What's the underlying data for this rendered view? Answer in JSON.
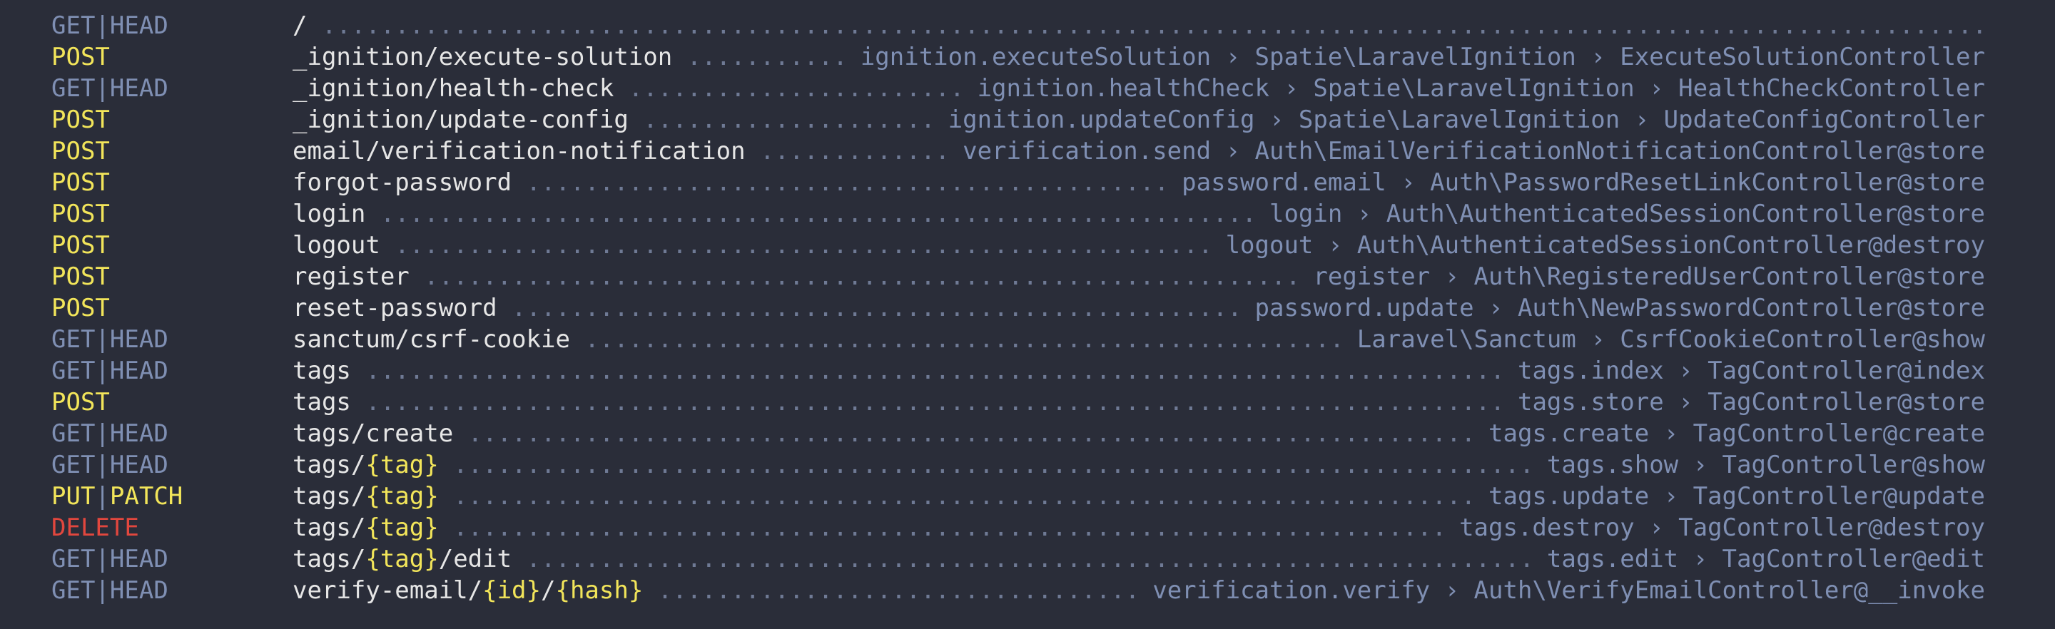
{
  "routes": [
    {
      "method": "GET|HEAD",
      "method_type": "get",
      "uri": "/",
      "target": ""
    },
    {
      "method": "POST",
      "method_type": "post",
      "uri": "_ignition/execute-solution",
      "target": "ignition.executeSolution › Spatie\\LaravelIgnition › ExecuteSolutionController"
    },
    {
      "method": "GET|HEAD",
      "method_type": "get",
      "uri": "_ignition/health-check",
      "target": "ignition.healthCheck › Spatie\\LaravelIgnition › HealthCheckController"
    },
    {
      "method": "POST",
      "method_type": "post",
      "uri": "_ignition/update-config",
      "target": "ignition.updateConfig › Spatie\\LaravelIgnition › UpdateConfigController"
    },
    {
      "method": "POST",
      "method_type": "post",
      "uri": "email/verification-notification",
      "target": "verification.send › Auth\\EmailVerificationNotificationController@store"
    },
    {
      "method": "POST",
      "method_type": "post",
      "uri": "forgot-password",
      "target": "password.email › Auth\\PasswordResetLinkController@store"
    },
    {
      "method": "POST",
      "method_type": "post",
      "uri": "login",
      "target": "login › Auth\\AuthenticatedSessionController@store"
    },
    {
      "method": "POST",
      "method_type": "post",
      "uri": "logout",
      "target": "logout › Auth\\AuthenticatedSessionController@destroy"
    },
    {
      "method": "POST",
      "method_type": "post",
      "uri": "register",
      "target": "register › Auth\\RegisteredUserController@store"
    },
    {
      "method": "POST",
      "method_type": "post",
      "uri": "reset-password",
      "target": "password.update › Auth\\NewPasswordController@store"
    },
    {
      "method": "GET|HEAD",
      "method_type": "get",
      "uri": "sanctum/csrf-cookie",
      "target": "Laravel\\Sanctum › CsrfCookieController@show"
    },
    {
      "method": "GET|HEAD",
      "method_type": "get",
      "uri": "tags",
      "target": "tags.index › TagController@index"
    },
    {
      "method": "POST",
      "method_type": "post",
      "uri": "tags",
      "target": "tags.store › TagController@store"
    },
    {
      "method": "GET|HEAD",
      "method_type": "get",
      "uri": "tags/create",
      "target": "tags.create › TagController@create"
    },
    {
      "method": "GET|HEAD",
      "method_type": "get",
      "uri": "tags/{tag}",
      "target": "tags.show › TagController@show"
    },
    {
      "method": "PUT|PATCH",
      "method_type": "put",
      "uri": "tags/{tag}",
      "target": "tags.update › TagController@update"
    },
    {
      "method": "DELETE",
      "method_type": "delete",
      "uri": "tags/{tag}",
      "target": "tags.destroy › TagController@destroy"
    },
    {
      "method": "GET|HEAD",
      "method_type": "get",
      "uri": "tags/{tag}/edit",
      "target": "tags.edit › TagController@edit"
    },
    {
      "method": "GET|HEAD",
      "method_type": "get",
      "uri": "verify-email/{id}/{hash}",
      "target": "verification.verify › Auth\\VerifyEmailController@__invoke"
    }
  ],
  "colors": {
    "background": "#2a2d39",
    "get": "#7f8fb3",
    "post": "#f2e55a",
    "put": "#f2e55a",
    "delete": "#e2473e",
    "param": "#f2e55a",
    "uri": "#e6e6e6",
    "target": "#7f8fb3"
  }
}
